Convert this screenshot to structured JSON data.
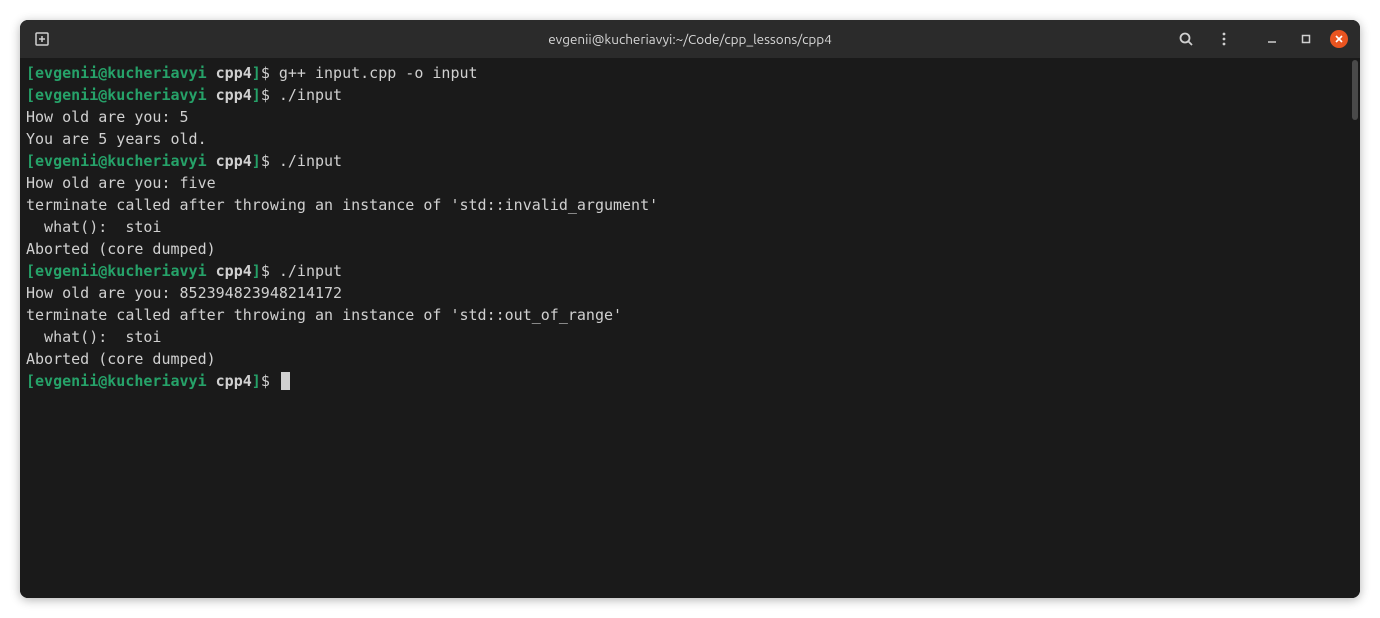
{
  "titlebar": {
    "title": "evgenii@kucheriavyi:~/Code/cpp_lessons/cpp4"
  },
  "prompt": {
    "open_bracket": "[",
    "user": "evgenii",
    "at": "@",
    "host": "kucheriavyi",
    "dir": "cpp4",
    "close_bracket": "]",
    "dollar": "$"
  },
  "lines": [
    {
      "type": "prompt",
      "cmd": "g++ input.cpp -o input"
    },
    {
      "type": "prompt",
      "cmd": "./input"
    },
    {
      "type": "output",
      "text": "How old are you: 5"
    },
    {
      "type": "output",
      "text": "You are 5 years old."
    },
    {
      "type": "prompt",
      "cmd": "./input"
    },
    {
      "type": "output",
      "text": "How old are you: five"
    },
    {
      "type": "output",
      "text": "terminate called after throwing an instance of 'std::invalid_argument'"
    },
    {
      "type": "output",
      "text": "  what():  stoi"
    },
    {
      "type": "output",
      "text": "Aborted (core dumped)"
    },
    {
      "type": "prompt",
      "cmd": "./input"
    },
    {
      "type": "output",
      "text": "How old are you: 852394823948214172"
    },
    {
      "type": "output",
      "text": "terminate called after throwing an instance of 'std::out_of_range'"
    },
    {
      "type": "output",
      "text": "  what():  stoi"
    },
    {
      "type": "output",
      "text": "Aborted (core dumped)"
    },
    {
      "type": "prompt",
      "cmd": "",
      "cursor": true
    }
  ],
  "colors": {
    "prompt_green": "#26a269",
    "text": "#d0d0d0",
    "background": "#1a1a1a",
    "close_button": "#e95420"
  }
}
